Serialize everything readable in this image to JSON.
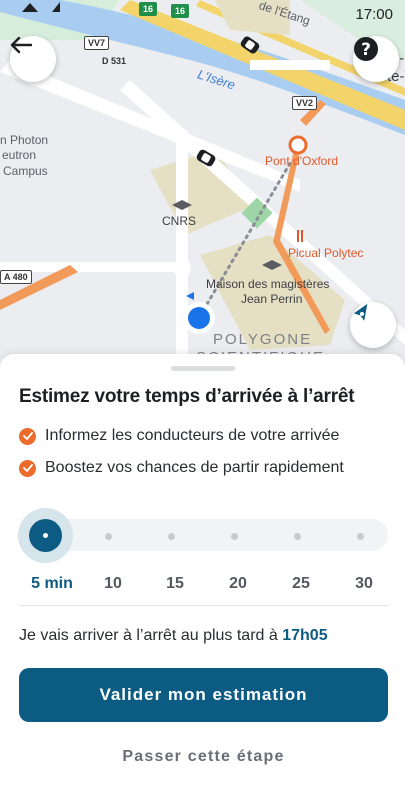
{
  "status_bar": {
    "time": "17:00"
  },
  "map": {
    "labels": {
      "river": "L'Isère",
      "cnrs": "CNRS",
      "maison": "Maison des magistères",
      "maison2": "Jean Perrin",
      "pont": "Pont d'Oxford",
      "picual": "Picual Polytec",
      "photon1": "n Photon",
      "photon2": "eutron",
      "photon3": "Campus",
      "polygone1": "POLYGONE",
      "polygone2": "SCIENTIFIQUE",
      "top_street": "de l'Étang",
      "top_right1": "t-",
      "top_right2": "te-V"
    },
    "roads": {
      "vv7": "VV7",
      "d531": "D 531",
      "vv2": "VV2",
      "a480": "A 480",
      "r16a": "16",
      "r16b": "16"
    }
  },
  "icons": {
    "back": "arrow-left-icon",
    "help": "question-mark-icon",
    "locate": "compass-icon",
    "check": "check-icon"
  },
  "sheet": {
    "title": "Estimez votre temps d’arrivée à l’arrêt",
    "bullets": [
      "Informez les conducteurs de votre arrivée",
      "Boostez vos chances de partir rapidement"
    ],
    "slider": {
      "selected_index": 0,
      "labels": [
        "5 min",
        "10",
        "15",
        "20",
        "25",
        "30"
      ]
    },
    "arrival_text": "Je vais arriver à l’arrêt au plus tard à",
    "arrival_time": "17h05",
    "primary_button": "Valider mon estimation",
    "skip_button": "Passer cette étape"
  },
  "colors": {
    "primary": "#0c5b82",
    "accent_orange": "#ec6b2d",
    "user_location": "#1a73e8"
  }
}
